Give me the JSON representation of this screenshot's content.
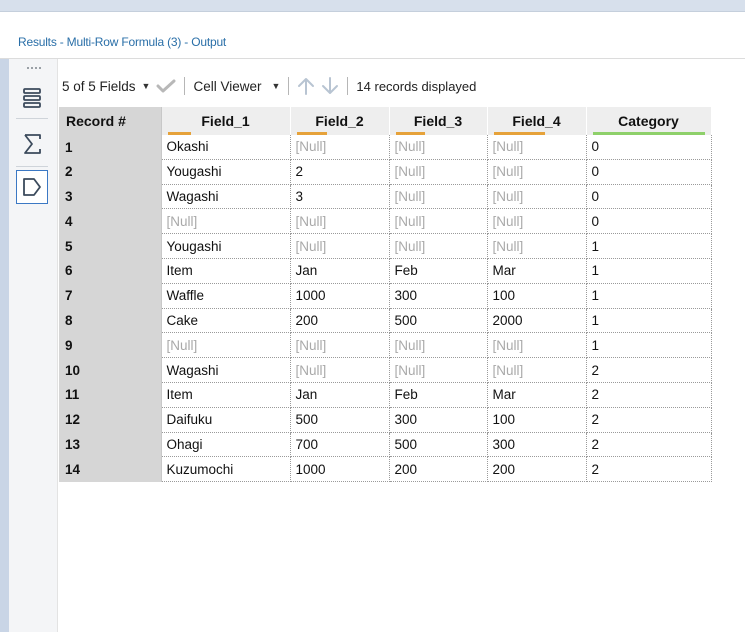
{
  "window": {
    "title": "Results - Multi-Row Formula (3) - Output"
  },
  "side_tools": [
    {
      "name": "table-view-icon"
    },
    {
      "name": "summary-sigma-icon"
    },
    {
      "name": "tag-view-icon"
    }
  ],
  "toolbar": {
    "fields_label": "5 of 5 Fields",
    "cell_viewer_label": "Cell Viewer",
    "records_label": "14 records displayed"
  },
  "grid": {
    "record_header": "Record #",
    "columns": [
      {
        "label": "Field_1",
        "bar_color": "#e6a23a",
        "bar_fill": 0.2
      },
      {
        "label": "Field_2",
        "bar_color": "#e6a23a",
        "bar_fill": 0.35
      },
      {
        "label": "Field_3",
        "bar_color": "#e6a23a",
        "bar_fill": 0.35
      },
      {
        "label": "Field_4",
        "bar_color": "#e6a23a",
        "bar_fill": 0.6
      },
      {
        "label": "Category",
        "bar_color": "#8ed06a",
        "bar_fill": 1.0
      }
    ],
    "rows": [
      {
        "record": "1",
        "cells": [
          "Okashi",
          "[Null]",
          "[Null]",
          "[Null]",
          "0"
        ]
      },
      {
        "record": "2",
        "cells": [
          "Yougashi",
          "2",
          "[Null]",
          "[Null]",
          "0"
        ]
      },
      {
        "record": "3",
        "cells": [
          "Wagashi",
          "3",
          "[Null]",
          "[Null]",
          "0"
        ]
      },
      {
        "record": "4",
        "cells": [
          "[Null]",
          "[Null]",
          "[Null]",
          "[Null]",
          "0"
        ]
      },
      {
        "record": "5",
        "cells": [
          "Yougashi",
          "[Null]",
          "[Null]",
          "[Null]",
          "1"
        ]
      },
      {
        "record": "6",
        "cells": [
          "Item",
          "Jan",
          "Feb",
          "Mar",
          "1"
        ]
      },
      {
        "record": "7",
        "cells": [
          "Waffle",
          "1000",
          "300",
          "100",
          "1"
        ]
      },
      {
        "record": "8",
        "cells": [
          "Cake",
          "200",
          "500",
          "2000",
          "1"
        ]
      },
      {
        "record": "9",
        "cells": [
          "[Null]",
          "[Null]",
          "[Null]",
          "[Null]",
          "1"
        ]
      },
      {
        "record": "10",
        "cells": [
          "Wagashi",
          "[Null]",
          "[Null]",
          "[Null]",
          "2"
        ]
      },
      {
        "record": "11",
        "cells": [
          "Item",
          "Jan",
          "Feb",
          "Mar",
          "2"
        ]
      },
      {
        "record": "12",
        "cells": [
          "Daifuku",
          "500",
          "300",
          "100",
          "2"
        ]
      },
      {
        "record": "13",
        "cells": [
          "Ohagi",
          "700",
          "500",
          "300",
          "2"
        ]
      },
      {
        "record": "14",
        "cells": [
          "Kuzumochi",
          "1000",
          "200",
          "200",
          "2"
        ]
      }
    ]
  },
  "colors": {
    "accent_blue": "#2a6fa8",
    "null_gray": "#a9a9a9",
    "record_col_bg": "#d6d6d6",
    "header_bg": "#eeeeee"
  }
}
